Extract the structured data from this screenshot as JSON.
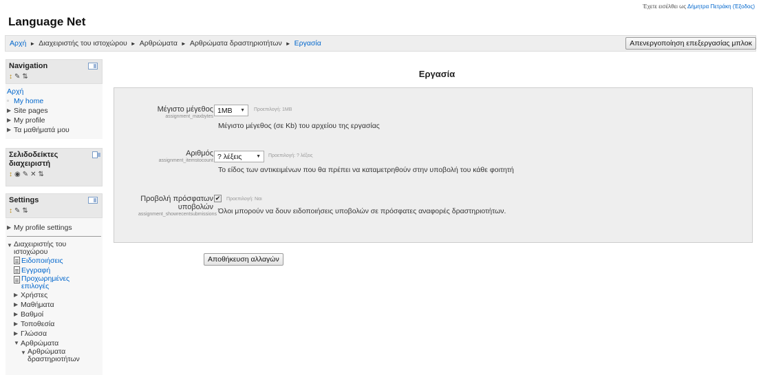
{
  "header": {
    "site_title": "Language Net",
    "login_prefix": "Έχετε εισέλθει ως",
    "user_name": "Δήμητρα Πετράκη",
    "logout_label": "(Έξοδος)"
  },
  "breadcrumb": {
    "items": [
      "Αρχή",
      "Διαχειριστής του ιστοχώρου",
      "Αρθρώματα",
      "Αρθρώματα δραστηριοτήτων",
      "Εργασία"
    ],
    "separator": "►"
  },
  "turn_editing_off_label": "Απενεργοποίηση επεξεργασίας μπλοκ",
  "blocks": {
    "navigation": {
      "title": "Navigation",
      "home": "Αρχή",
      "items": [
        "My home",
        "Site pages",
        "My profile",
        "Τα μαθήματά μου"
      ]
    },
    "bookmarks": {
      "title": "Σελιδοδείκτες διαχειριστή"
    },
    "settings": {
      "title": "Settings",
      "profile_settings": "My profile settings",
      "site_admin": "Διαχειριστής του ιστοχώρου",
      "pages": [
        "Ειδοποιήσεις",
        "Εγγραφή",
        "Προχωρημένες επιλογές"
      ],
      "categories": [
        "Χρήστες",
        "Μαθήματα",
        "Βαθμοί",
        "Τοποθεσία",
        "Γλώσσα"
      ],
      "plugins": "Αρθρώματα",
      "activity_modules": "Αρθρώματα δραστηριοτήτων"
    }
  },
  "main": {
    "heading": "Εργασία",
    "fields": {
      "maxbytes": {
        "label": "Μέγιστο μέγεθος",
        "name": "assignment_maxbytes",
        "value": "1MB",
        "default": "Προεπιλογή: 1MB",
        "description": "Μέγιστο μέγεθος (σε Kb) του αρχείου της εργασίας"
      },
      "itemstocount": {
        "label": "Αριθμός",
        "name": "assignment_itemstocount",
        "value": "? λέξεις",
        "default": "Προεπιλογή: ? λέξεις",
        "description": "Το είδος των αντικειμένων που θα πρέπει να καταμετρηθούν στην υποβολή του κάθε φοιτητή"
      },
      "showrecent": {
        "label_line1": "Προβολή πρόσφατων",
        "label_line2": "υποβολών",
        "name": "assignment_showrecentsubmissions",
        "checked": true,
        "default": "Προεπιλογή: Ναι",
        "description": "Όλοι μπορούν να δουν ειδοποιήσεις υποβολών σε πρόσφατες αναφορές δραστηριοτήτων."
      }
    },
    "save_label": "Αποθήκευση αλλαγών"
  },
  "icons": [
    "move-icon",
    "edit-icon",
    "delete-icon",
    "hide-icon",
    "move-up-down-icon",
    "dock-icon",
    "triangle-icon",
    "file-icon",
    "checkbox-icon"
  ]
}
